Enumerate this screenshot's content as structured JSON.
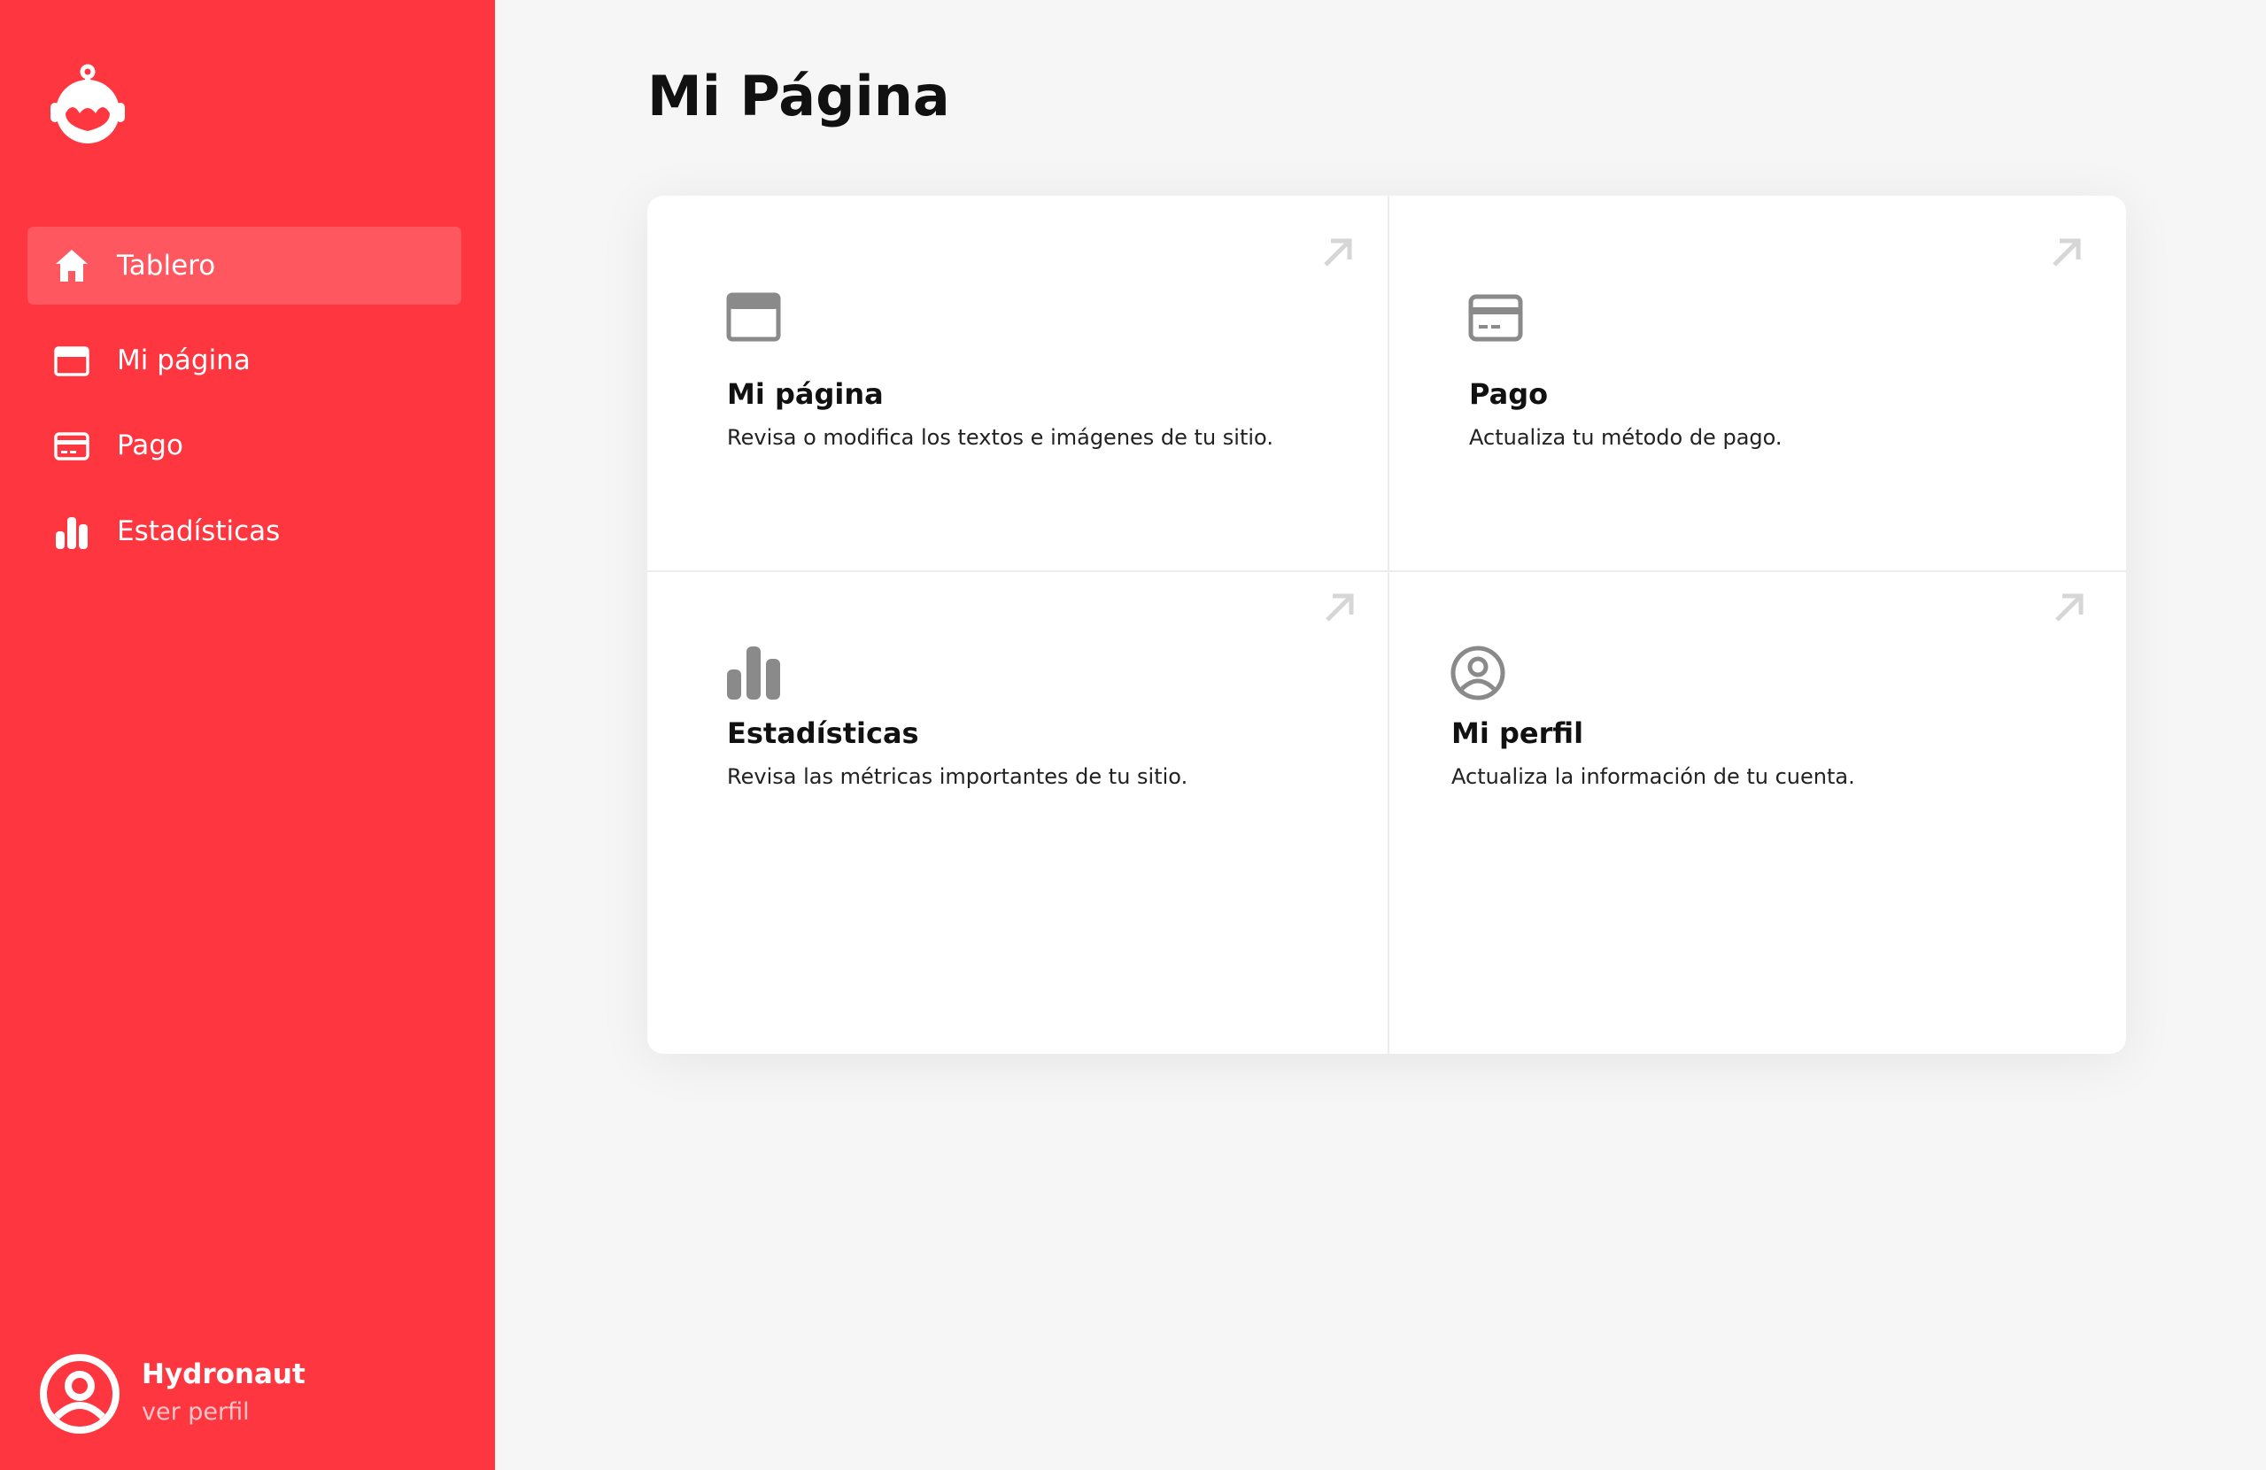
{
  "colors": {
    "brand": "#fe3640",
    "active_item": "#fe5760",
    "background": "#f6f6f6",
    "card": "#ffffff",
    "icon_gray": "#8a8a8a",
    "arrow_gray": "#d6d6d6"
  },
  "sidebar": {
    "logo_icon": "robot-logo-icon",
    "items": [
      {
        "label": "Tablero",
        "icon": "home-icon",
        "active": true
      },
      {
        "label": "Mi página",
        "icon": "browser-window-icon",
        "active": false
      },
      {
        "label": "Pago",
        "icon": "credit-card-icon",
        "active": false
      },
      {
        "label": "Estadísticas",
        "icon": "bar-chart-icon",
        "active": false
      }
    ],
    "profile": {
      "name": "Hydronaut",
      "link": "ver perfil",
      "icon": "user-circle-icon"
    }
  },
  "main": {
    "title": "Mi Página",
    "cards": [
      {
        "title": "Mi página",
        "description": "Revisa o modifica los textos e imágenes de tu sitio.",
        "icon": "browser-window-icon"
      },
      {
        "title": "Pago",
        "description": "Actualiza tu método de pago.",
        "icon": "credit-card-icon"
      },
      {
        "title": "Estadísticas",
        "description": "Revisa las métricas importantes de tu sitio.",
        "icon": "bar-chart-icon"
      },
      {
        "title": "Mi perfil",
        "description": "Actualiza la información de tu cuenta.",
        "icon": "user-circle-icon"
      }
    ]
  }
}
